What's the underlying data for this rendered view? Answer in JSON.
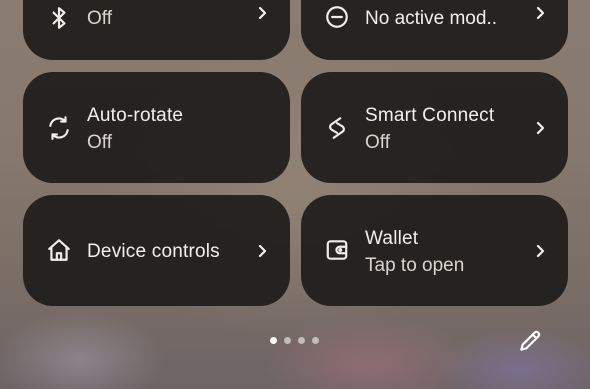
{
  "tiles": {
    "bluetooth": {
      "subtitle": "Off",
      "icon": "bluetooth-icon"
    },
    "modes": {
      "subtitle": "No active mod..",
      "icon": "do-not-disturb-icon"
    },
    "auto_rotate": {
      "title": "Auto-rotate",
      "subtitle": "Off",
      "icon": "auto-rotate-icon"
    },
    "smart_connect": {
      "title": "Smart Connect",
      "subtitle": "Off",
      "icon": "smart-connect-icon"
    },
    "device_controls": {
      "title": "Device controls",
      "icon": "home-icon"
    },
    "wallet": {
      "title": "Wallet",
      "subtitle": "Tap to open",
      "icon": "wallet-icon"
    }
  },
  "pager": {
    "page_count": 4,
    "active_page": 1
  },
  "edit": {
    "icon": "pencil-icon"
  },
  "colors": {
    "tile_bg": "#1e1c1b",
    "text_primary": "#f3f0ec",
    "text_secondary": "#d9d4cf"
  }
}
